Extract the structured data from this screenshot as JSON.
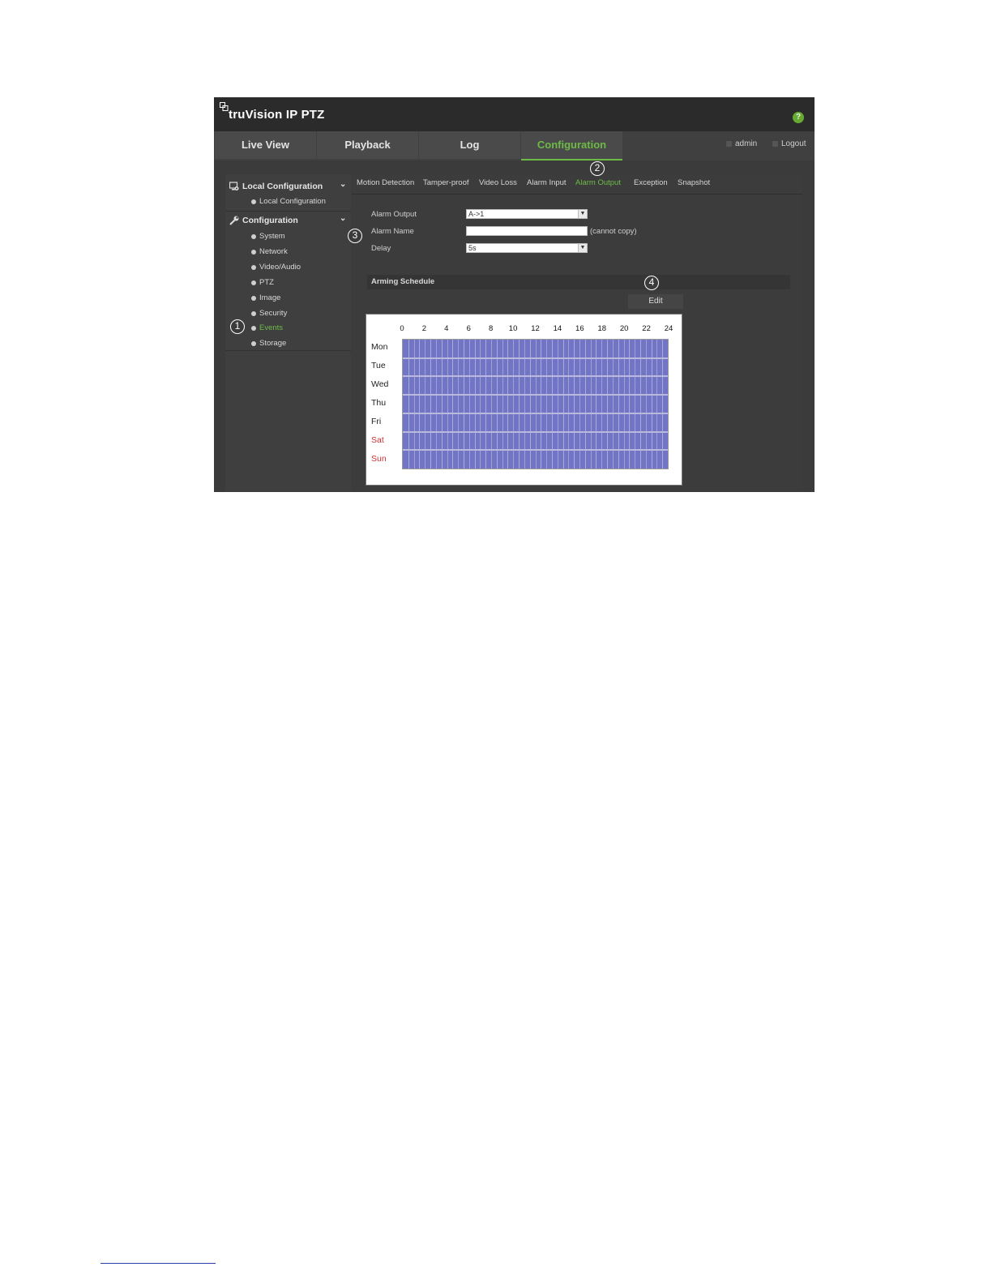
{
  "header": {
    "brand": "truVision IP PTZ",
    "help_glyph": "?",
    "help_color": "#66aa33"
  },
  "nav": {
    "tabs": [
      {
        "label": "Live View"
      },
      {
        "label": "Playback"
      },
      {
        "label": "Log"
      },
      {
        "label": "Configuration",
        "active": true
      }
    ],
    "user": "admin",
    "logout": "Logout",
    "accent_color": "#6dbb47"
  },
  "sidebar": {
    "groups": [
      {
        "label": "Local Configuration",
        "icon": "monitor-gear-icon",
        "items": [
          "Local Configuration"
        ]
      },
      {
        "label": "Configuration",
        "icon": "wrench-icon",
        "items": [
          "System",
          "Network",
          "Video/Audio",
          "PTZ",
          "Image",
          "Security",
          "Events",
          "Storage"
        ]
      }
    ],
    "active_item": "Events"
  },
  "subtabs": {
    "items": [
      "Motion Detection",
      "Tamper-proof",
      "Video Loss",
      "Alarm Input",
      "Alarm Output",
      "Exception",
      "Snapshot"
    ],
    "active": "Alarm Output"
  },
  "form": {
    "alarm_output_label": "Alarm Output",
    "alarm_output_value": "A->1",
    "alarm_name_label": "Alarm Name",
    "alarm_name_value": "",
    "cannot_copy": "(cannot copy)",
    "delay_label": "Delay",
    "delay_value": "5s"
  },
  "arming": {
    "title": "Arming Schedule",
    "edit_label": "Edit"
  },
  "schedule": {
    "hours": [
      "0",
      "2",
      "4",
      "6",
      "8",
      "10",
      "12",
      "14",
      "16",
      "18",
      "20",
      "22",
      "24"
    ],
    "days": [
      {
        "label": "Mon",
        "weekend": false
      },
      {
        "label": "Tue",
        "weekend": false
      },
      {
        "label": "Wed",
        "weekend": false
      },
      {
        "label": "Thu",
        "weekend": false
      },
      {
        "label": "Fri",
        "weekend": false
      },
      {
        "label": "Sat",
        "weekend": true
      },
      {
        "label": "Sun",
        "weekend": true
      }
    ],
    "armed_color": "#7274c6",
    "weekend_color": "#cc3333",
    "coverage": "all days, 0-24"
  },
  "callouts": [
    "1",
    "2",
    "3",
    "4"
  ]
}
